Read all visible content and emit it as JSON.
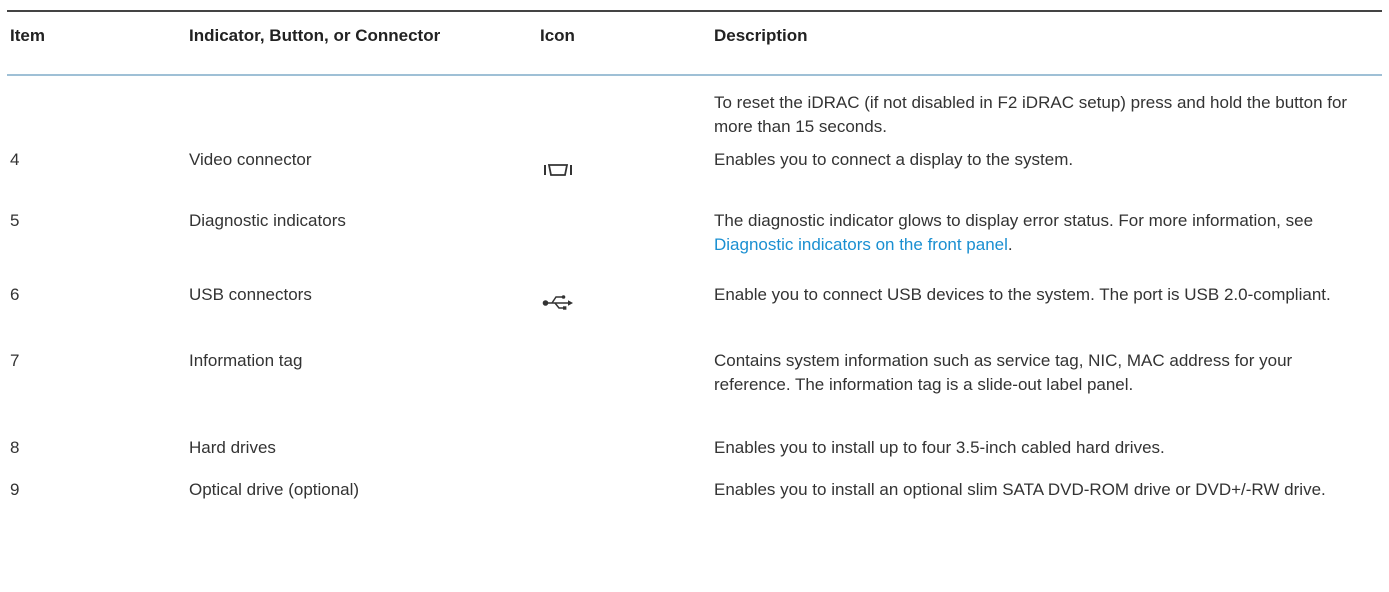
{
  "header": {
    "item": "Item",
    "indicator": "Indicator, Button, or Connector",
    "icon": "Icon",
    "description": "Description"
  },
  "rows": [
    {
      "item": "",
      "indicator": "",
      "icon": "",
      "description": "To reset the iDRAC (if not disabled in F2 iDRAC setup) press and hold the button for more than 15 seconds."
    },
    {
      "item": "4",
      "indicator": "Video connector",
      "icon": "video-connector-icon",
      "description": "Enables you to connect a display to the system."
    },
    {
      "item": "5",
      "indicator": "Diagnostic indicators",
      "icon": "",
      "description_before_link": "The diagnostic indicator glows to display error status. For more information, see ",
      "description_link": "Diagnostic indicators on the front panel",
      "description_after_link": "."
    },
    {
      "item": "6",
      "indicator": "USB connectors",
      "icon": "usb-icon",
      "description": "Enable you to connect USB devices to the system. The port is USB 2.0-compliant."
    },
    {
      "item": "7",
      "indicator": "Information tag",
      "icon": "",
      "description": "Contains system information such as service tag, NIC, MAC address for your reference. The information tag is a slide-out label panel."
    },
    {
      "item": "8",
      "indicator": "Hard drives",
      "icon": "",
      "description": "Enables you to install up to four 3.5-inch cabled hard drives."
    },
    {
      "item": "9",
      "indicator": "Optical drive (optional)",
      "icon": "",
      "description": "Enables you to install an optional slim SATA DVD-ROM drive or DVD+/-RW drive."
    }
  ],
  "colors": {
    "text": "#333333",
    "link": "#1a8fd1",
    "top_rule": "#444444",
    "header_rule": "#9fc0d6"
  }
}
